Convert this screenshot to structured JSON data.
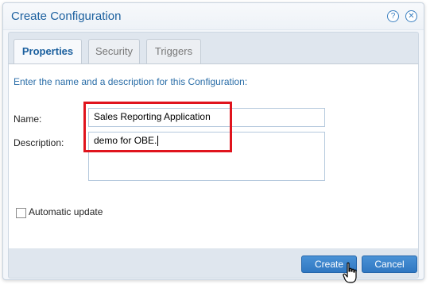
{
  "dialog": {
    "title": "Create Configuration",
    "icons": {
      "help": "help-icon",
      "close": "close-icon"
    }
  },
  "tabs": [
    {
      "label": "Properties",
      "active": true
    },
    {
      "label": "Security",
      "active": false
    },
    {
      "label": "Triggers",
      "active": false
    }
  ],
  "form": {
    "intro": "Enter the name and a description for this Configuration:",
    "name_label": "Name:",
    "name_value": "Sales Reporting Application",
    "description_label": "Description:",
    "description_value": "demo for OBE.",
    "auto_update_label": "Automatic update",
    "auto_update_checked": false
  },
  "buttons": {
    "create": "Create",
    "cancel": "Cancel"
  },
  "colors": {
    "accent": "#1a5f9e",
    "button": "#2f77c2",
    "highlight": "#e0141d"
  }
}
